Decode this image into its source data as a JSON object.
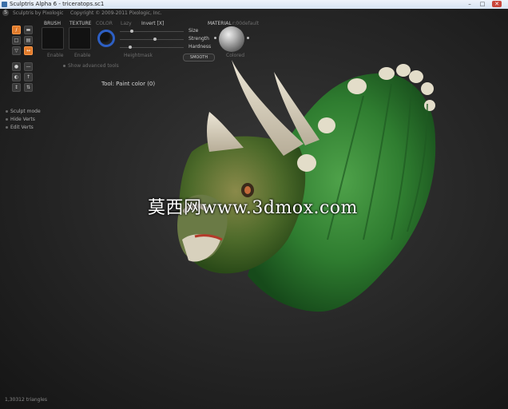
{
  "window": {
    "title": "Sculptris Alpha 6 - triceratops.sc1",
    "minimize": "–",
    "maximize": "□",
    "close": "✕"
  },
  "header": {
    "product": "Sculptris by Pixologic",
    "copyright": "Copyright © 2009-2011 Pixologic, Inc."
  },
  "panel": {
    "brush_label": "BRUSH",
    "texture_label": "TEXTURE",
    "color_label": "COLOR",
    "lazy_label": "Lazy",
    "invert_label": "Invert [X]",
    "brush_enable": "Enable",
    "texture_enable": "Enable",
    "size_label": "Size",
    "strength_label": "Strength",
    "hardness_label": "Hardness",
    "heightmask_label": "Heightmask",
    "smooth_button": "SMOOTH",
    "material_label": "MATERIAL",
    "material_name": "r:00default",
    "colored_label": "Colored",
    "show_advanced": "Show advanced tools",
    "accent_color": "#2d5fc4"
  },
  "tools": {
    "active_color": "#e07a2a",
    "items": [
      {
        "name": "paint-color",
        "glyph": "/",
        "active": true
      },
      {
        "name": "paint-bump",
        "glyph": "▬",
        "active": false
      },
      {
        "name": "tool-3",
        "glyph": "□",
        "active": false
      },
      {
        "name": "tool-4",
        "glyph": "▤",
        "active": false
      },
      {
        "name": "mask",
        "glyph": "▽",
        "active": false
      },
      {
        "name": "tool-6",
        "glyph": "↔",
        "active": true
      },
      {
        "name": "tool-7",
        "glyph": "●",
        "active": false
      },
      {
        "name": "tool-8",
        "glyph": "—",
        "active": false
      },
      {
        "name": "tool-9",
        "glyph": "◐",
        "active": false
      },
      {
        "name": "tool-10",
        "glyph": "↑",
        "active": false
      },
      {
        "name": "tool-11",
        "glyph": "↕",
        "active": false
      },
      {
        "name": "tool-12",
        "glyph": "⇅",
        "active": false
      }
    ]
  },
  "modes": {
    "sculpt": "Sculpt mode",
    "hide_verts": "Hide Verts",
    "edit_verts": "Edit Verts"
  },
  "viewport": {
    "tool_info": "Tool: Paint color (0)",
    "watermark": "莫西网www.3dmox.com"
  },
  "status": {
    "triangles": "1,30312 triangles"
  }
}
